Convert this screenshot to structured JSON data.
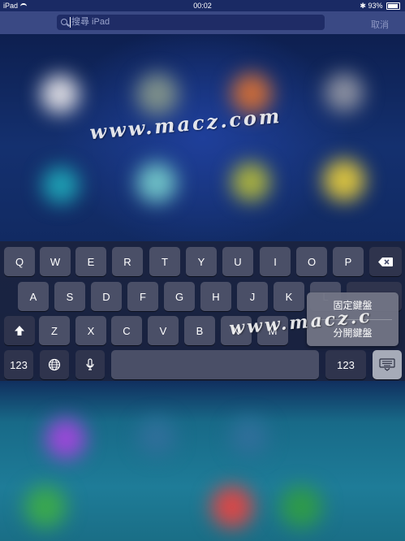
{
  "status_bar": {
    "device": "iPad",
    "time": "00:02",
    "battery": "93%",
    "battery_level": 0.93
  },
  "search": {
    "placeholder": "搜尋 iPad",
    "cancel_label": "取消"
  },
  "keyboard": {
    "row1": [
      "Q",
      "W",
      "E",
      "R",
      "T",
      "Y",
      "U",
      "I",
      "O",
      "P"
    ],
    "row2": [
      "A",
      "S",
      "D",
      "F",
      "G",
      "H",
      "J",
      "K",
      "L"
    ],
    "row3": [
      "Z",
      "X",
      "C",
      "V",
      "B",
      "N",
      "M"
    ],
    "numbers_key": "123",
    "numbers_key_right": "123"
  },
  "keyboard_menu": {
    "items": [
      "固定鍵盤",
      "分開鍵盤"
    ]
  },
  "watermark": {
    "text": "www.macz.com"
  },
  "icons": {
    "wifi": "wifi-icon",
    "bluetooth": "bluetooth-icon",
    "battery": "battery-icon",
    "search": "search-icon",
    "backspace": "backspace-icon",
    "shift": "shift-icon",
    "globe": "globe-icon",
    "mic": "microphone-icon",
    "hide_keyboard": "keyboard-hide-icon"
  }
}
